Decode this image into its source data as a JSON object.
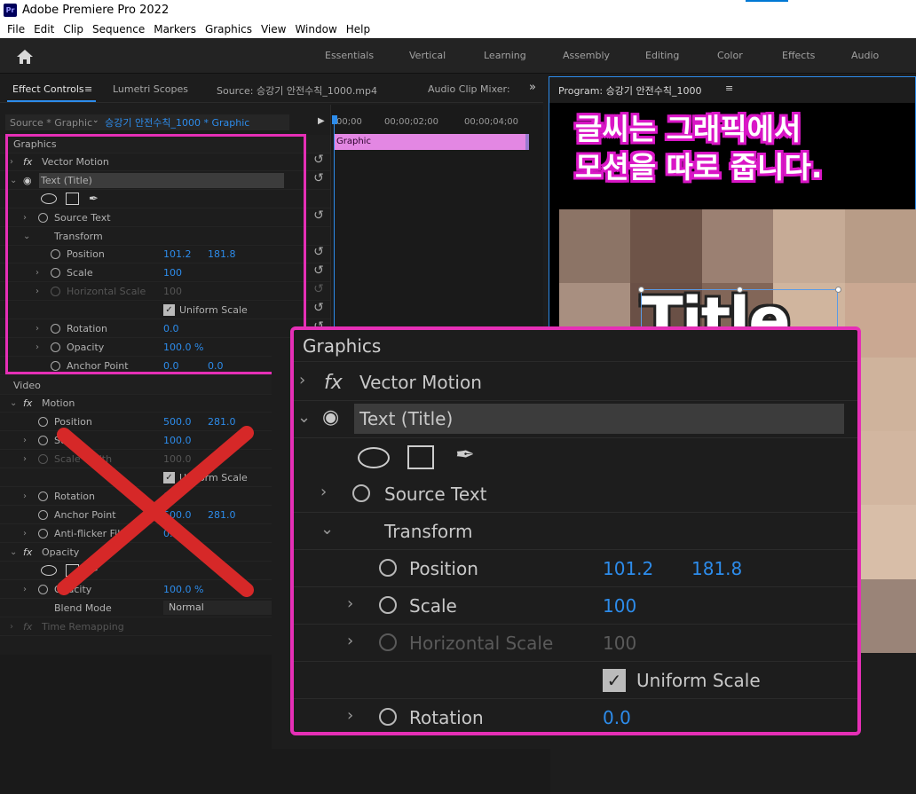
{
  "window": {
    "app_icon": "Pr",
    "title": "Adobe Premiere Pro 2022"
  },
  "menu": [
    "File",
    "Edit",
    "Clip",
    "Sequence",
    "Markers",
    "Graphics",
    "View",
    "Window",
    "Help"
  ],
  "workspaces": [
    "Essentials",
    "Vertical",
    "Learning",
    "Assembly",
    "Editing",
    "Color",
    "Effects",
    "Audio"
  ],
  "tabs": {
    "effect_controls": "Effect Controls",
    "lumetri": "Lumetri Scopes",
    "source": "Source: 승강기 안전수칙_1000.mp4",
    "audio_mixer": "Audio Clip Mixer:",
    "program": "Program: 승강기 안전수칙_1000"
  },
  "source_row": {
    "label": "Source * Graphic",
    "clip": "승강기 안전수칙_1000 * Graphic"
  },
  "timeline": {
    "t0": "00;00",
    "t1": "00;00;02;00",
    "t2": "00;00;04;00",
    "clip_label": "Graphic"
  },
  "graphics_section": {
    "header": "Graphics",
    "vector_motion": "Vector Motion",
    "text_layer": "Text (Title)",
    "source_text": "Source Text",
    "transform": "Transform",
    "position": {
      "label": "Position",
      "x": "101.2",
      "y": "181.8"
    },
    "scale": {
      "label": "Scale",
      "value": "100"
    },
    "horizontal_scale": {
      "label": "Horizontal Scale",
      "value": "100"
    },
    "uniform_scale": "Uniform Scale",
    "rotation": {
      "label": "Rotation",
      "value": "0.0"
    },
    "opacity": {
      "label": "Opacity",
      "value": "100.0 %"
    },
    "anchor": {
      "label": "Anchor Point",
      "x": "0.0",
      "y": "0.0"
    }
  },
  "video_section": {
    "header": "Video",
    "motion": "Motion",
    "position": {
      "label": "Position",
      "x": "500.0",
      "y": "281.0"
    },
    "scale": {
      "label": "Scale",
      "value": "100.0"
    },
    "scale_width": {
      "label": "Scale Width",
      "value": "100.0"
    },
    "uniform_scale": "Uniform Scale",
    "rotation": {
      "label": "Rotation",
      "value": "0.0"
    },
    "anchor": {
      "label": "Anchor Point",
      "x": "500.0",
      "y": "281.0"
    },
    "antiflicker": {
      "label": "Anti-flicker Filter",
      "value": "0.00"
    },
    "opacity_group": "Opacity",
    "opacity": {
      "label": "Opacity",
      "value": "100.0 %"
    },
    "blend_mode": {
      "label": "Blend Mode",
      "value": "Normal"
    },
    "time_remap": "Time Remapping"
  },
  "program_monitor": {
    "caption_line1": "글씨는 그래픽에서",
    "caption_line2": "모션을 따로 줍니다.",
    "title_text": "Title"
  },
  "zoom": {
    "header": "Graphics",
    "vector_motion": "Vector Motion",
    "text_layer": "Text (Title)",
    "source_text": "Source Text",
    "transform": "Transform",
    "position": {
      "label": "Position",
      "x": "101.2",
      "y": "181.8"
    },
    "scale": {
      "label": "Scale",
      "value": "100"
    },
    "horizontal_scale": {
      "label": "Horizontal Scale",
      "value": "100"
    },
    "uniform_scale": "Uniform Scale",
    "rotation": {
      "label": "Rotation",
      "value": "0.0"
    }
  },
  "colors": {
    "accent": "#2d8ceb",
    "highlight": "#e52fb6",
    "cross": "#d62828",
    "clip": "#e387e3"
  }
}
